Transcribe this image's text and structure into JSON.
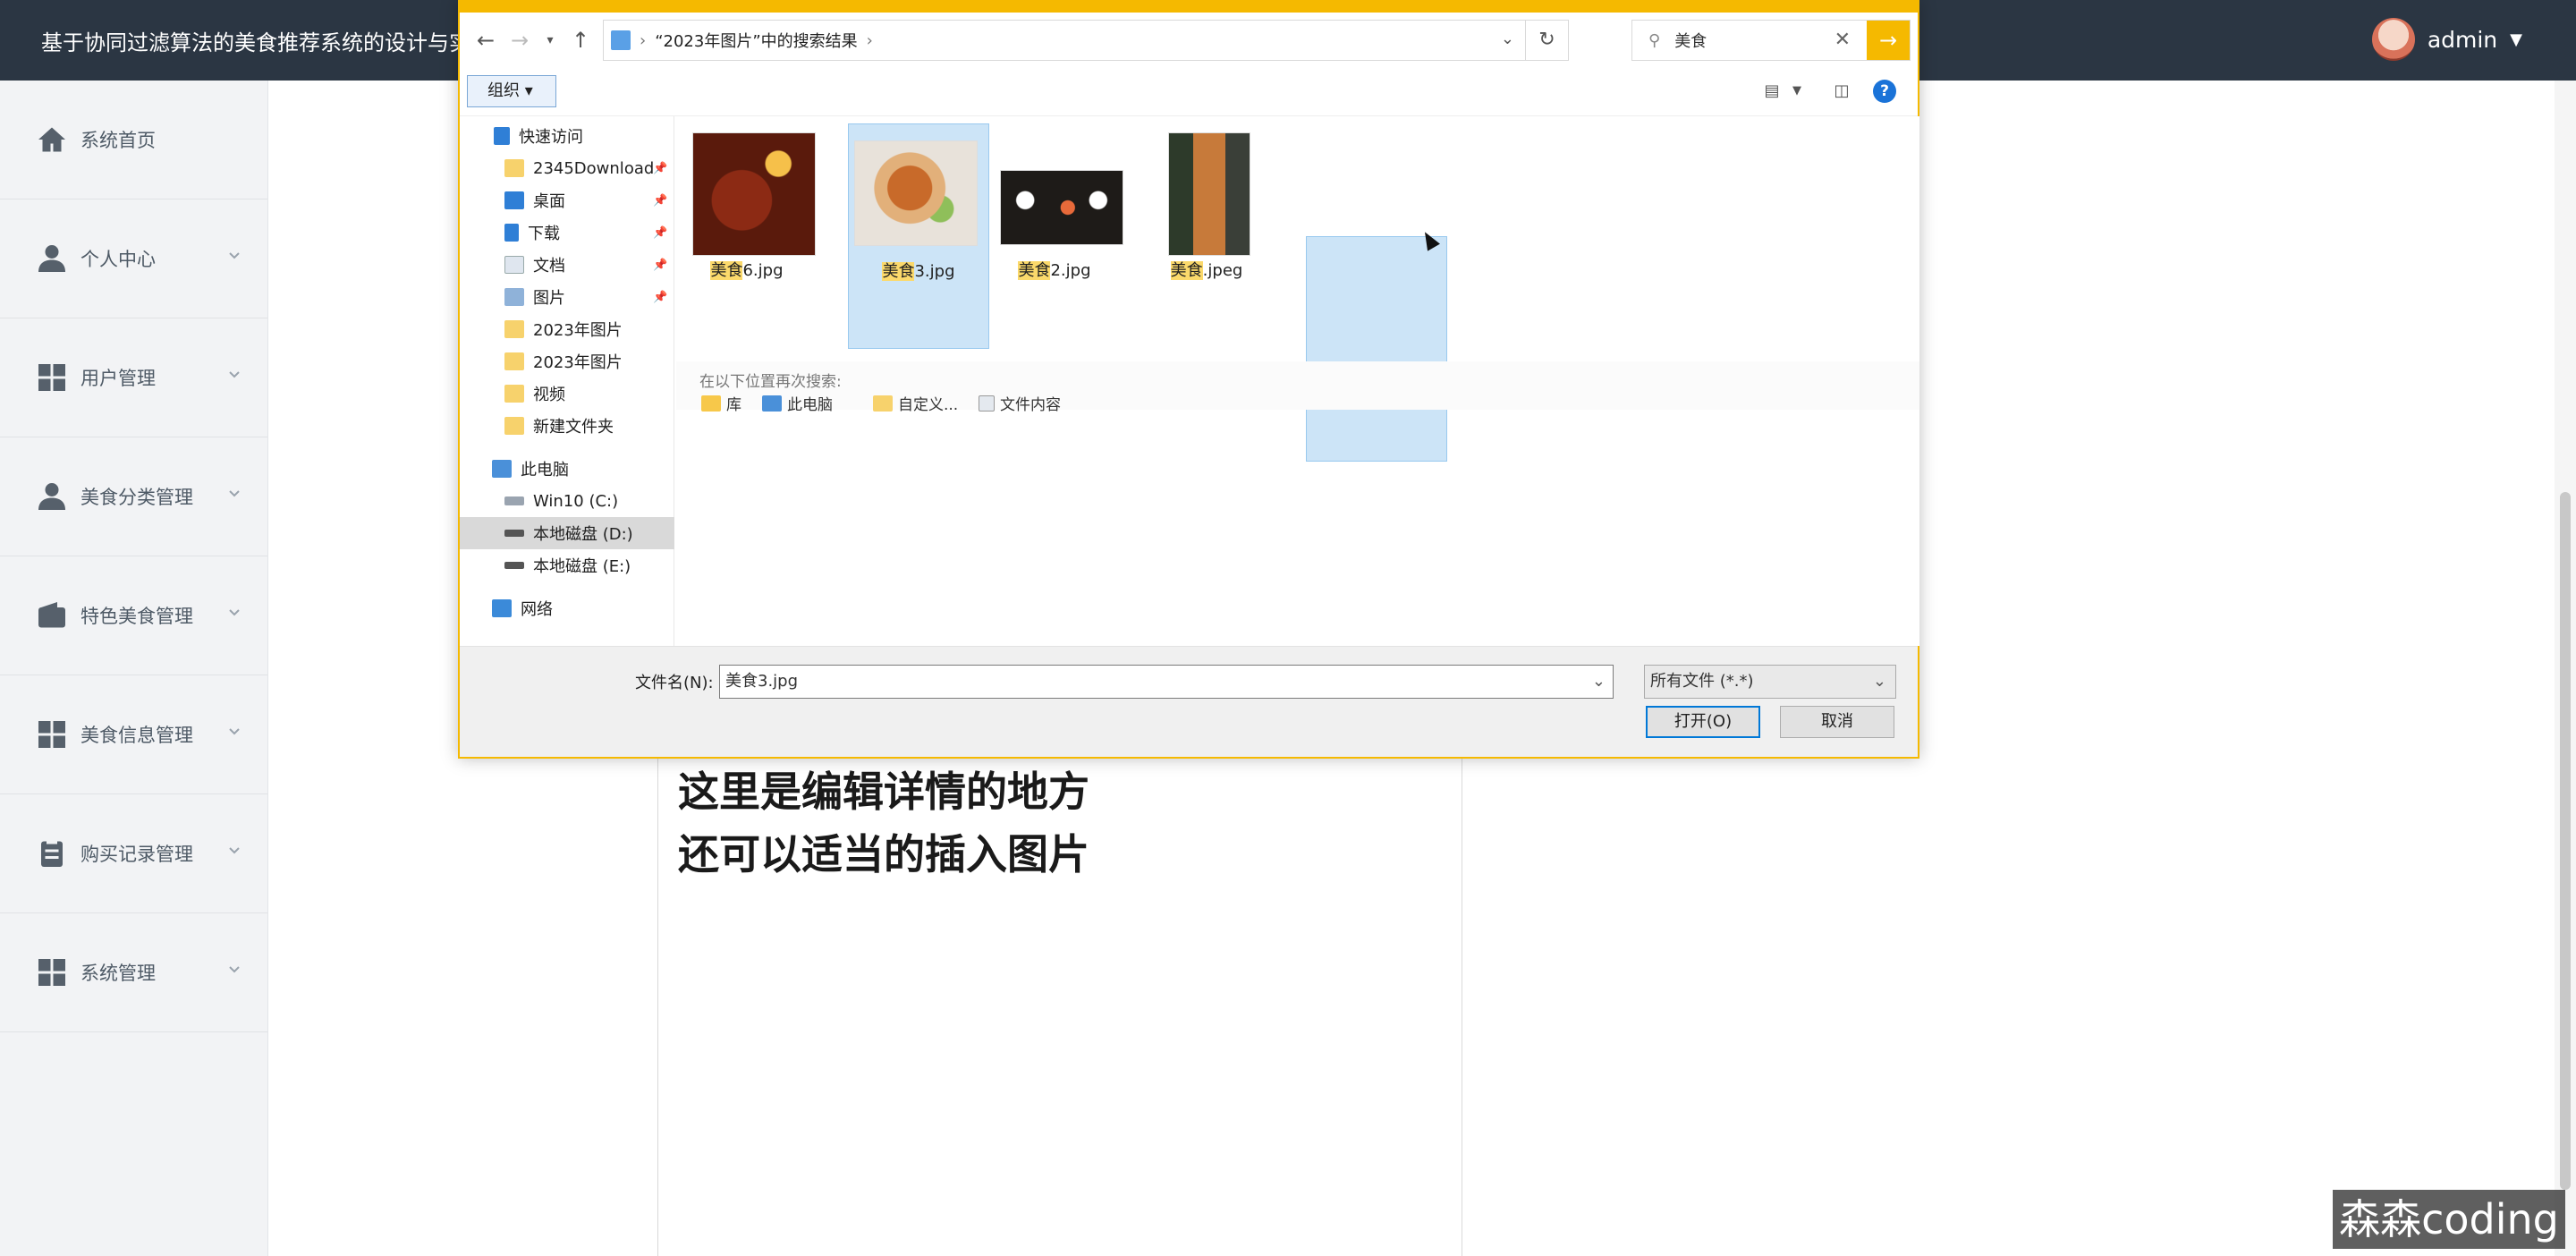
{
  "app": {
    "title": "基于协同过滤算法的美食推荐系统的设计与实现",
    "user": "admin",
    "user_caret": "▼"
  },
  "sidebar": {
    "items": [
      {
        "label": "系统首页",
        "icon": "home-icon"
      },
      {
        "label": "个人中心",
        "icon": "user-icon"
      },
      {
        "label": "用户管理",
        "icon": "grid-icon"
      },
      {
        "label": "美食分类管理",
        "icon": "user-icon"
      },
      {
        "label": "特色美食管理",
        "icon": "wallet-icon"
      },
      {
        "label": "美食信息管理",
        "icon": "grid-icon"
      },
      {
        "label": "购买记录管理",
        "icon": "clipboard-icon"
      },
      {
        "label": "系统管理",
        "icon": "grid-icon"
      }
    ]
  },
  "editor": {
    "line1": "这里是编辑详情的地方",
    "line2": "还可以适当的插入图片"
  },
  "watermark": "森森coding",
  "dialog": {
    "address": "“2023年图片”中的搜索结果",
    "address_sep": "›",
    "search_value": "美食",
    "organize_label": "组织 ▾",
    "nav": [
      {
        "label": "快速访问",
        "kind": "quick",
        "pinned": false
      },
      {
        "label": "2345Download",
        "kind": "folder",
        "pinned": true
      },
      {
        "label": "桌面",
        "kind": "desktop",
        "pinned": true
      },
      {
        "label": "下载",
        "kind": "download",
        "pinned": true
      },
      {
        "label": "文档",
        "kind": "doc",
        "pinned": true
      },
      {
        "label": "图片",
        "kind": "pic",
        "pinned": true
      },
      {
        "label": "2023年图片",
        "kind": "folder",
        "pinned": false
      },
      {
        "label": "2023年图片",
        "kind": "folder",
        "pinned": false
      },
      {
        "label": "视频",
        "kind": "folder",
        "pinned": false
      },
      {
        "label": "新建文件夹",
        "kind": "folder",
        "pinned": false
      },
      {
        "label": "此电脑",
        "kind": "pc",
        "pinned": false
      },
      {
        "label": "Win10 (C:)",
        "kind": "drive",
        "pinned": false
      },
      {
        "label": "本地磁盘 (D:)",
        "kind": "drive",
        "pinned": false
      },
      {
        "label": "本地磁盘 (E:)",
        "kind": "drive",
        "pinned": false
      },
      {
        "label": "网络",
        "kind": "net",
        "pinned": false
      }
    ],
    "files": [
      {
        "hl": "美食",
        "rest": "6.jpg",
        "selected": false
      },
      {
        "hl": "美食",
        "rest": "3.jpg",
        "selected": true
      },
      {
        "hl": "美食",
        "rest": "2.jpg",
        "selected": false
      },
      {
        "hl": "美食",
        "rest": ".jpeg",
        "selected": false
      }
    ],
    "research_title": "在以下位置再次搜索:",
    "research_links": [
      "库",
      "此电脑",
      "自定义...",
      "文件内容"
    ],
    "filename_label": "文件名(N):",
    "filename_value": "美食3.jpg",
    "filetype_value": "所有文件 (*.*)",
    "open_label": "打开(O)",
    "cancel_label": "取消"
  }
}
